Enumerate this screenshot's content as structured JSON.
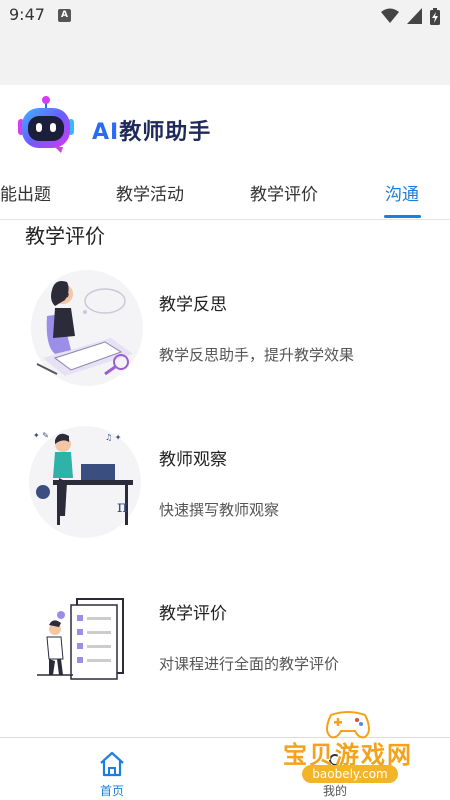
{
  "status_bar": {
    "time": "9:47",
    "notification_icon": "A",
    "icons": [
      "wifi-icon",
      "cellular-icon",
      "battery-charging-icon"
    ]
  },
  "header": {
    "title_ai": "AI",
    "title_rest": "教师助手"
  },
  "tabs": [
    {
      "label": "能出题",
      "active": false
    },
    {
      "label": "教学活动",
      "active": false
    },
    {
      "label": "教学评价",
      "active": false
    },
    {
      "label": "沟通",
      "active": true
    }
  ],
  "section": {
    "title": "教学评价"
  },
  "cards": [
    {
      "title": "教学反思",
      "desc": "教学反思助手，提升教学效果",
      "icon": "reflection-illustration"
    },
    {
      "title": "教师观察",
      "desc": "快速撰写教师观察",
      "icon": "observation-illustration"
    },
    {
      "title": "教学评价",
      "desc": "对课程进行全面的教学评价",
      "icon": "evaluation-illustration"
    }
  ],
  "bottom_nav": {
    "home_label": "首页",
    "mine_label": "我的"
  },
  "watermark": {
    "text": "宝贝游戏网",
    "url": "baobely.com"
  },
  "colors": {
    "accent": "#1a7fe0",
    "title_dark": "#1f2a5a",
    "watermark": "#f2a21b"
  }
}
